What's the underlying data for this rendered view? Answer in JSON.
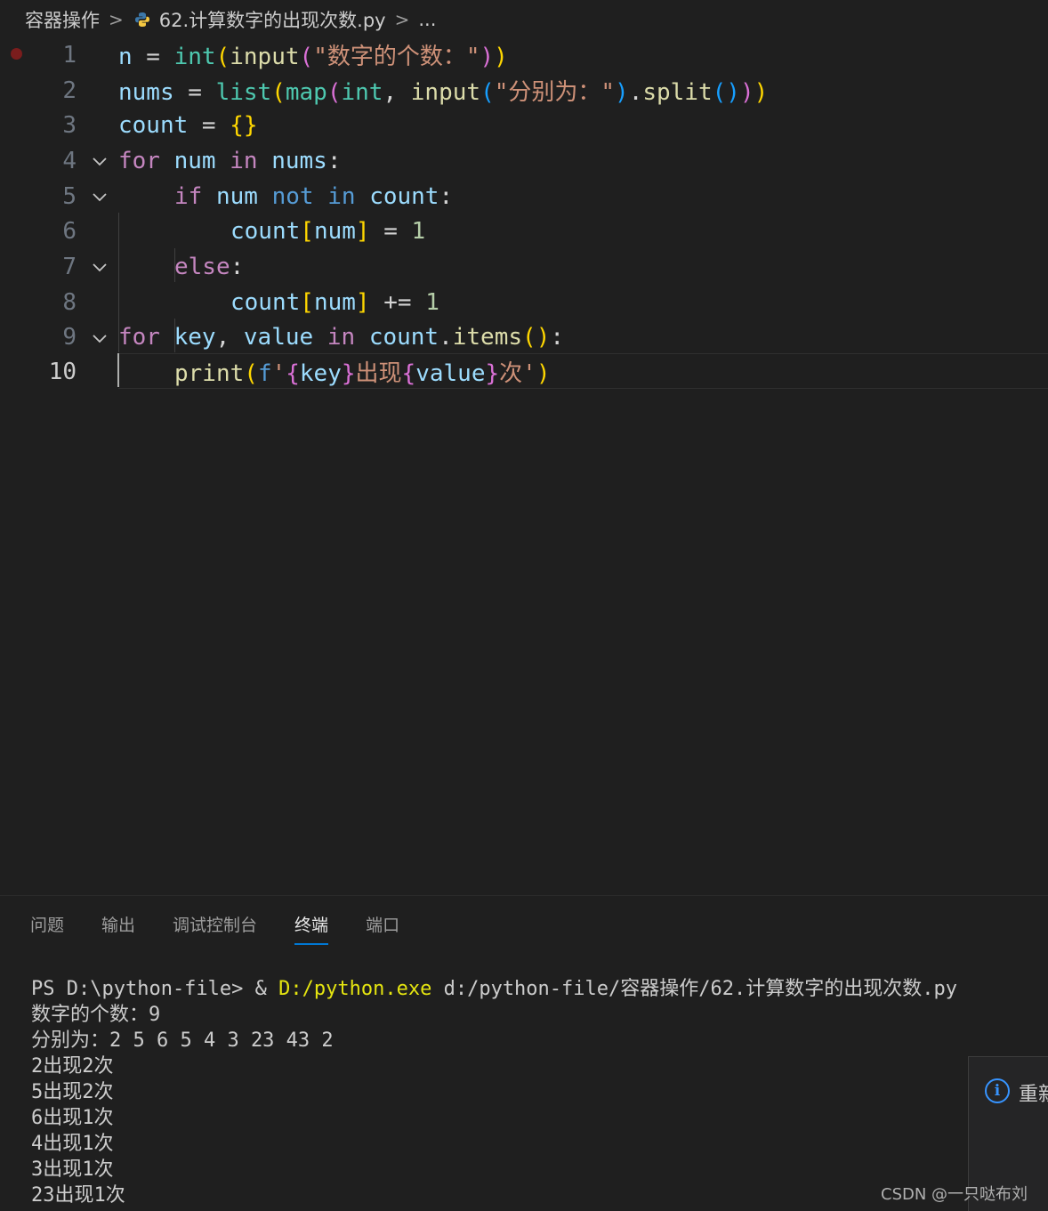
{
  "breadcrumb": {
    "folder": "容器操作",
    "file": "62.计算数字的出现次数.py",
    "more": "..."
  },
  "editor": {
    "active_line": 10,
    "lines": [
      {
        "num": "1"
      },
      {
        "num": "2"
      },
      {
        "num": "3"
      },
      {
        "num": "4"
      },
      {
        "num": "5"
      },
      {
        "num": "6"
      },
      {
        "num": "7"
      },
      {
        "num": "8"
      },
      {
        "num": "9"
      },
      {
        "num": "10"
      }
    ],
    "tokens": {
      "l1": [
        "n",
        " = ",
        "int",
        "(",
        "input",
        "(",
        "\"数字的个数：\"",
        ")",
        ")"
      ],
      "l2": [
        "nums",
        " = ",
        "list",
        "(",
        "map",
        "(",
        "int",
        ", ",
        "input",
        "(",
        "\"分别为：\"",
        ")",
        ".",
        "split",
        "(",
        ")",
        ")",
        ")"
      ],
      "l3": [
        "count",
        " = ",
        "{",
        "}"
      ],
      "l4": [
        "for",
        " ",
        "num",
        " ",
        "in",
        " ",
        "nums",
        ":"
      ],
      "l5": [
        "if",
        " ",
        "num",
        " ",
        "not",
        " ",
        "in",
        " ",
        "count",
        ":"
      ],
      "l6": [
        "count",
        "[",
        "num",
        "]",
        " = ",
        "1"
      ],
      "l7": [
        "else",
        ":"
      ],
      "l8": [
        "count",
        "[",
        "num",
        "]",
        " += ",
        "1"
      ],
      "l9": [
        "for",
        " ",
        "key",
        ", ",
        "value",
        " ",
        "in",
        " ",
        "count",
        ".",
        "items",
        "(",
        ")",
        ":"
      ],
      "l10": [
        "print",
        "(",
        "f",
        "'",
        "{",
        "key",
        "}",
        "出现",
        "{",
        "value",
        "}",
        "次",
        "'",
        ")"
      ]
    }
  },
  "panel": {
    "tabs": [
      "问题",
      "输出",
      "调试控制台",
      "终端",
      "端口"
    ],
    "active_tab": "终端"
  },
  "terminal": {
    "prompt": "PS D:\\python-file> & ",
    "exe": "D:/python.exe",
    "script": " d:/python-file/容器操作/62.计算数字的出现次数.py",
    "lines": [
      "数字的个数：9",
      "分别为：2 5 6 5 4 3 23 43 2",
      "2出现2次",
      "5出现2次",
      "6出现1次",
      "4出现1次",
      "3出现1次",
      "23出现1次"
    ]
  },
  "toast": {
    "text": "重新"
  },
  "watermark": "CSDN @一只哒布刘",
  "colors": {
    "accent": "#0078d4",
    "background": "#1f1f1f"
  }
}
